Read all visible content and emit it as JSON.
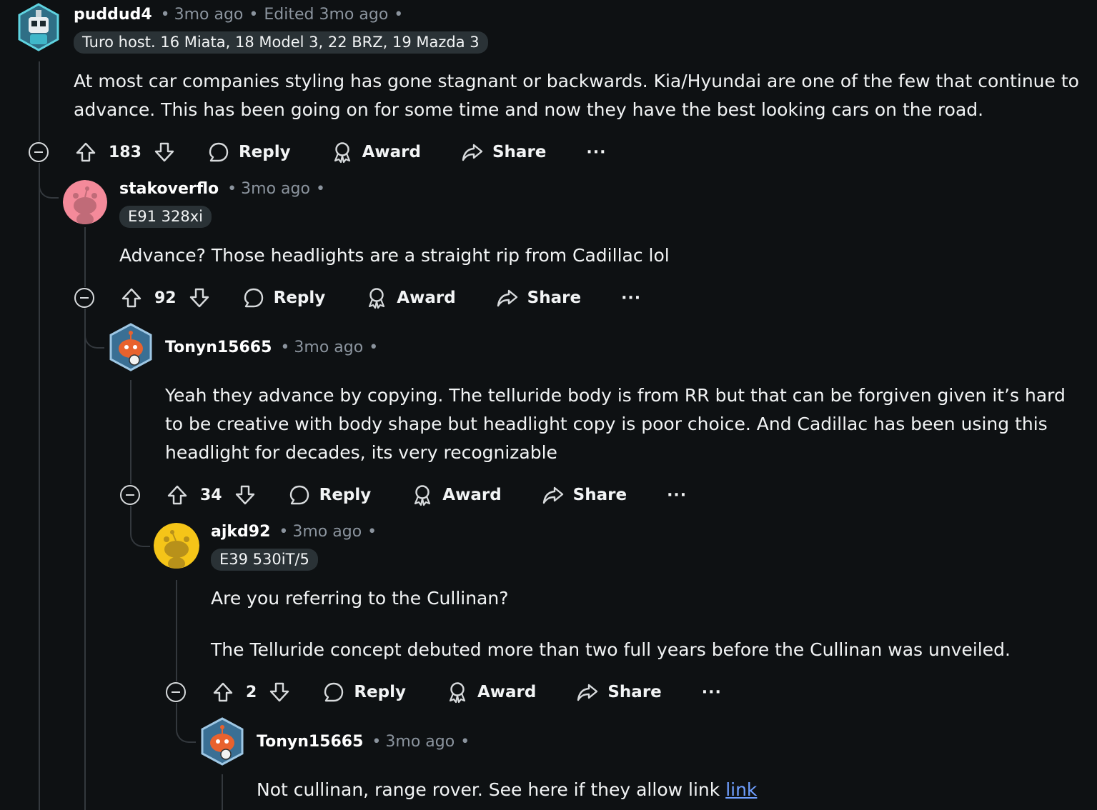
{
  "comments": [
    {
      "username": "puddud4",
      "time": "3mo ago",
      "edited": "Edited 3mo ago",
      "flair": "Turo host. 16 Miata, 18 Model 3, 22 BRZ, 19 Mazda 3",
      "body": [
        "At most car companies styling has gone stagnant or backwards. Kia/Hyundai are one of the few that continue to advance. This has been going on for some time and now they have the best looking cars on the road."
      ],
      "votes": "183",
      "avatar": "robot-avatar-teal"
    },
    {
      "username": "stakoverflo",
      "time": "3mo ago",
      "flair": "E91 328xi",
      "body": [
        "Advance? Those headlights are a straight rip from Cadillac lol"
      ],
      "votes": "92",
      "avatar": "snoo-avatar-pink"
    },
    {
      "username": "Tonyn15665",
      "time": "3mo ago",
      "body": [
        "Yeah they advance by copying. The telluride body is from RR but that can be forgiven given it’s hard to be creative with body shape but headlight copy is poor choice. And Cadillac has been using this headlight for decades, its very recognizable"
      ],
      "votes": "34",
      "avatar": "snoo-avatar-hex-orange"
    },
    {
      "username": "ajkd92",
      "time": "3mo ago",
      "flair": "E39 530iT/5",
      "body": [
        "Are you referring to the Cullinan?",
        "The Telluride concept debuted more than two full years before the Cullinan was unveiled."
      ],
      "votes": "2",
      "avatar": "snoo-avatar-yellow"
    },
    {
      "username": "Tonyn15665",
      "time": "3mo ago",
      "body": [
        "Not cullinan, range rover. See here if they allow link"
      ],
      "link": "link",
      "avatar": "snoo-avatar-hex-orange"
    }
  ],
  "actions": {
    "reply": "Reply",
    "award": "Award",
    "share": "Share",
    "more": "···"
  },
  "bullet": "•",
  "colors": {
    "background": "#0e1113",
    "text": "#f2f4f5",
    "muted": "#8b949e",
    "flair_bg": "#2a3236",
    "link": "#6f9fff",
    "thread_line": "#33383d"
  }
}
